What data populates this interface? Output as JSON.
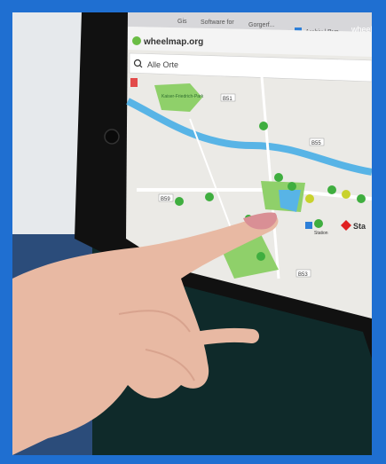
{
  "photo": {
    "description_hidden": "",
    "tablet": {
      "browser_tabs": [
        "Gis",
        "Software for",
        "Gorgerf...",
        "Archiv | Bun",
        "wheel"
      ],
      "url_title": "wheelmap.org",
      "search_placeholder": "Alle Orte",
      "map_labels": {
        "park_label": "Kaiser-Friedrich-Park",
        "road_shield_1": "B51",
        "road_shield_2": "B55",
        "road_shield_3": "B59",
        "road_shield_4": "B53",
        "station_label": "Sta",
        "station_small": "Station"
      }
    }
  },
  "colors": {
    "frame_border": "#1f6fd1",
    "map_background": "#e9e8e3",
    "river": "#58b4e6",
    "park": "#8fd06a",
    "marker_green": "#3fae3f",
    "marker_yellow": "#c9d22d",
    "skin": "#e8b9a3",
    "tablet_body": "#111111"
  }
}
